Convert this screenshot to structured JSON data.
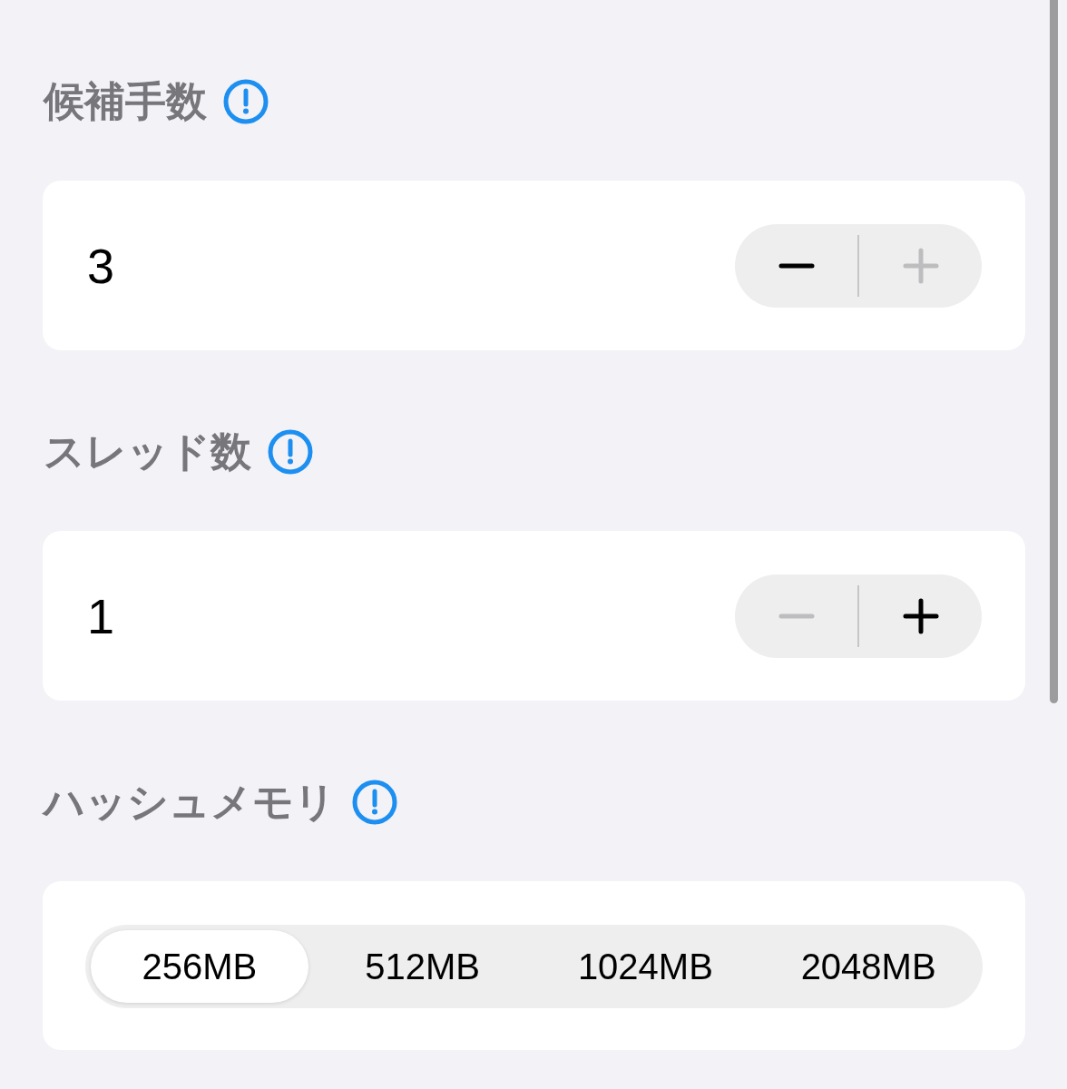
{
  "sections": [
    {
      "title": "候補手数",
      "kind": "stepper",
      "value": "3",
      "decrement": {
        "disabled": false
      },
      "increment": {
        "disabled": true
      }
    },
    {
      "title": "スレッド数",
      "kind": "stepper",
      "value": "1",
      "decrement": {
        "disabled": true
      },
      "increment": {
        "disabled": false
      }
    },
    {
      "title": "ハッシュメモリ",
      "kind": "segmented",
      "options": [
        {
          "label": "256MB",
          "selected": true
        },
        {
          "label": "512MB",
          "selected": false
        },
        {
          "label": "1024MB",
          "selected": false
        },
        {
          "label": "2048MB",
          "selected": false
        }
      ]
    }
  ]
}
